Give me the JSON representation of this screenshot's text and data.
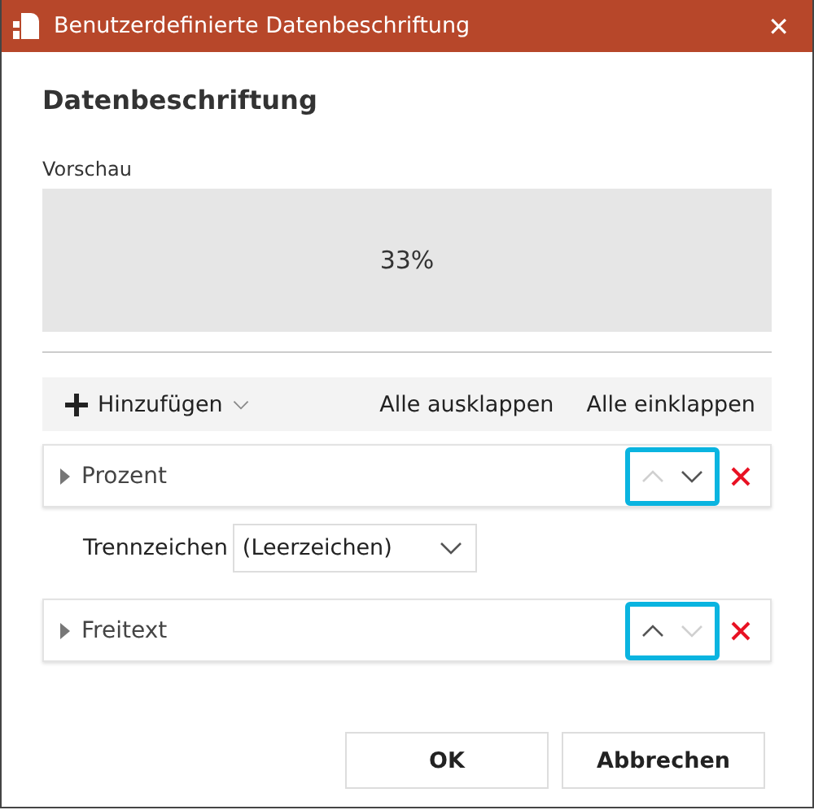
{
  "window": {
    "title": "Benutzerdefinierte Datenbeschriftung",
    "close": "✕"
  },
  "heading": "Datenbeschriftung",
  "preview": {
    "label": "Vorschau",
    "value": "33%"
  },
  "toolbar": {
    "add": "Hinzufügen",
    "expand_all": "Alle ausklappen",
    "collapse_all": "Alle einklappen"
  },
  "entries": [
    {
      "kind": "field",
      "label": "Prozent",
      "expanded": false,
      "up_disabled": true,
      "down_disabled": false,
      "highlighted": true
    },
    {
      "kind": "separator",
      "label": "Trennzeichen",
      "value": "(Leerzeichen)"
    },
    {
      "kind": "field",
      "label": "Freitext",
      "expanded": false,
      "up_disabled": false,
      "down_disabled": true,
      "highlighted": true
    }
  ],
  "buttons": [
    "OK",
    "Abbrechen"
  ]
}
